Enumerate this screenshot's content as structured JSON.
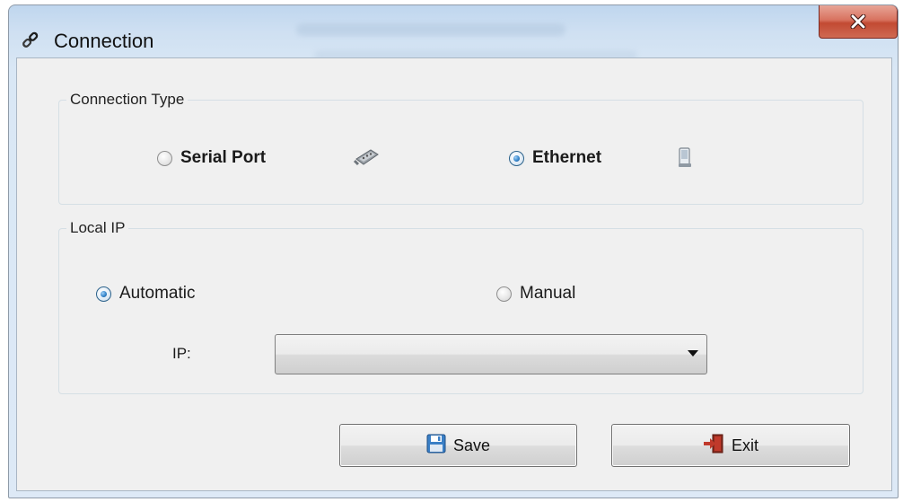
{
  "window": {
    "title": "Connection",
    "close_glyph": "X",
    "app_icon": "link-icon"
  },
  "connection_type": {
    "label": "Connection Type",
    "options": [
      {
        "label": "Serial Port",
        "checked": false,
        "icon": "serial-port-icon"
      },
      {
        "label": "Ethernet",
        "checked": true,
        "icon": "ethernet-icon"
      }
    ]
  },
  "local_ip": {
    "label": "Local IP",
    "options": [
      {
        "label": "Automatic",
        "checked": true
      },
      {
        "label": "Manual",
        "checked": false
      }
    ],
    "ip_label": "IP:",
    "ip_value": ""
  },
  "buttons": {
    "save_label": "Save",
    "save_icon": "floppy-disk-icon",
    "exit_label": "Exit",
    "exit_icon": "exit-door-icon"
  },
  "colors": {
    "titlebar": "#cfe0f2",
    "close_button": "#c24a33",
    "radio_checked": "#2e7fc7",
    "dialog_bg": "#f0f0f0"
  }
}
